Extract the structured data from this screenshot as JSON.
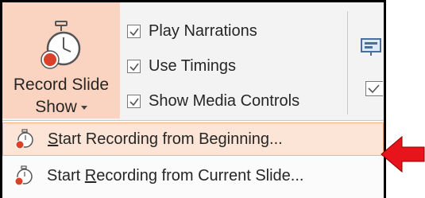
{
  "ribbon": {
    "record_button": {
      "line1": "Record Slide",
      "line2": "Show",
      "icon": "stopwatch-record-icon"
    },
    "checkboxes": [
      {
        "label": "Play Narrations",
        "checked": true
      },
      {
        "label": "Use Timings",
        "checked": true
      },
      {
        "label": "Show Media Controls",
        "checked": true
      }
    ]
  },
  "menu": {
    "items": [
      {
        "before": "",
        "accel": "S",
        "after": "tart Recording from Beginning...",
        "highlighted": true,
        "icon": "stopwatch-record-icon"
      },
      {
        "before": "Start ",
        "accel": "R",
        "after": "ecording from Current Slide...",
        "highlighted": false,
        "icon": "stopwatch-record-icon"
      }
    ]
  },
  "annotation": {
    "icon": "red-arrow-icon",
    "color": "#e8141c"
  },
  "colors": {
    "button_active_bg": "#fbd4c1",
    "menu_highlight_bg": "#fce4d6",
    "menu_highlight_border": "#f4b183",
    "record_red": "#d9412a"
  }
}
